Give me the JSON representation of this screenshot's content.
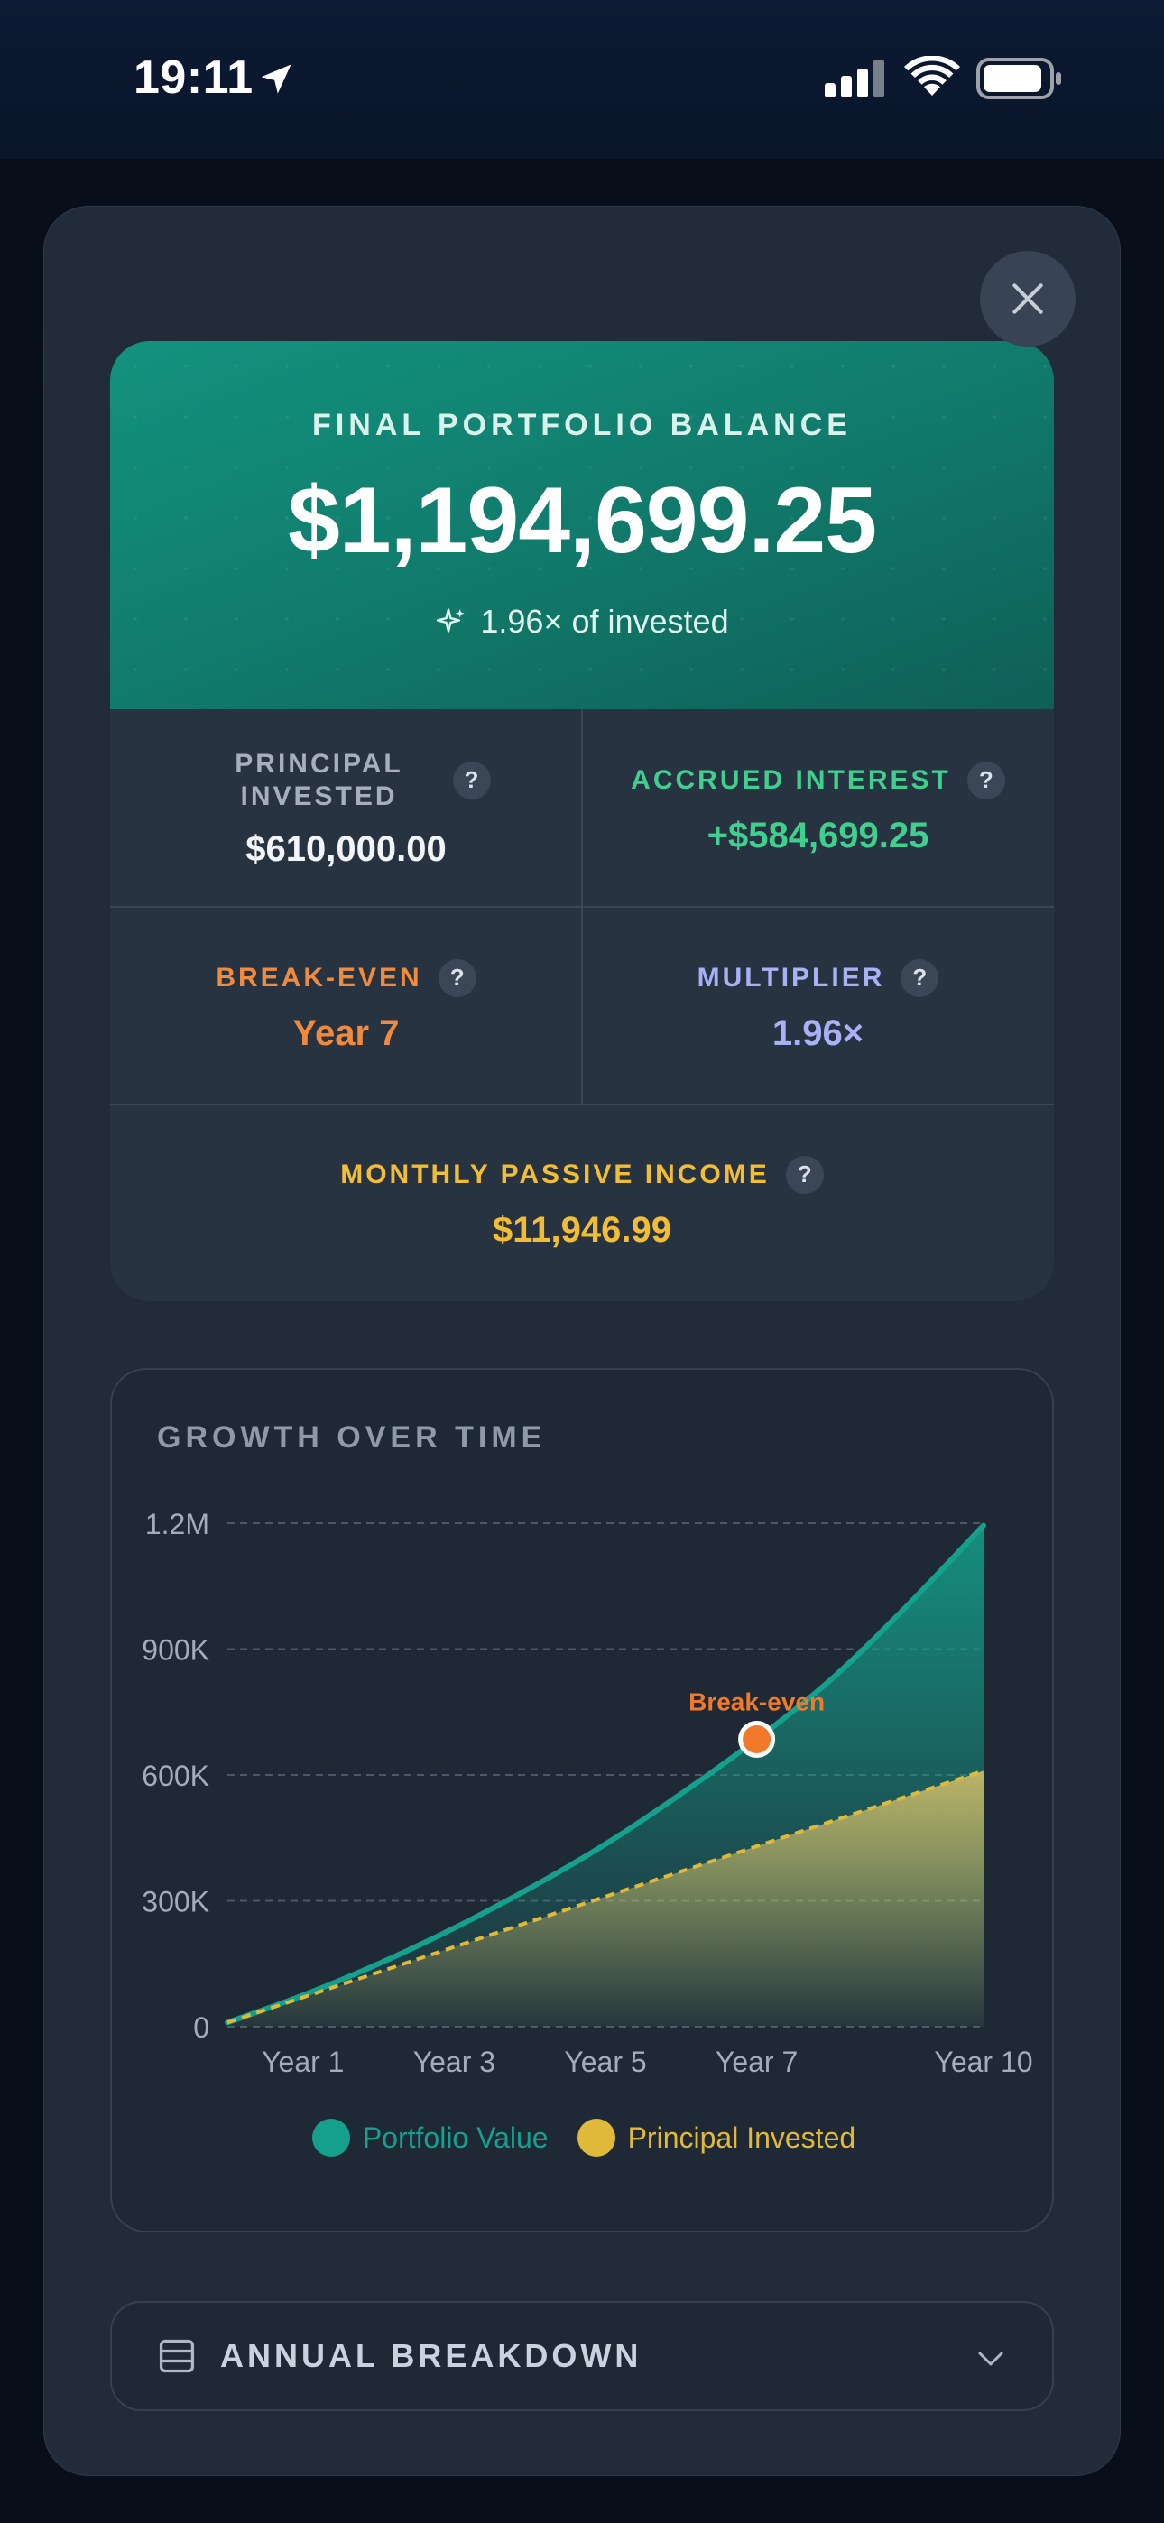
{
  "status_bar": {
    "time": "19:11"
  },
  "results": {
    "hero_title": "FINAL PORTFOLIO BALANCE",
    "hero_amount": "$1,194,699.25",
    "hero_sub": "1.96× of invested",
    "principal_label": "PRINCIPAL INVESTED",
    "principal_value": "$610,000.00",
    "interest_label": "ACCRUED INTEREST",
    "interest_value": "+$584,699.25",
    "breakeven_label": "BREAK-EVEN",
    "breakeven_value": "Year 7",
    "multiplier_label": "MULTIPLIER",
    "multiplier_value": "1.96×",
    "passive_label": "MONTHLY PASSIVE INCOME",
    "passive_value": "$11,946.99",
    "help_glyph": "?"
  },
  "colors": {
    "accent_teal": "#14a08c",
    "principal_gold": "#e0b93b",
    "breakeven_orange": "#f08a3e",
    "interest_green": "#3fcf8e",
    "multiplier_purple": "#a9b0f5",
    "passive_gold": "#f2bd36"
  },
  "chart": {
    "title": "GROWTH OVER TIME"
  },
  "chart_data": {
    "type": "area",
    "title": "GROWTH OVER TIME",
    "xlabel": "",
    "ylabel": "",
    "x": [
      0,
      1,
      2,
      3,
      4,
      5,
      6,
      7,
      8,
      9,
      10
    ],
    "x_tick_labels": [
      {
        "x": 1,
        "label": "Year 1"
      },
      {
        "x": 3,
        "label": "Year 3"
      },
      {
        "x": 5,
        "label": "Year 5"
      },
      {
        "x": 7,
        "label": "Year 7"
      },
      {
        "x": 10,
        "label": "Year 10"
      }
    ],
    "y_ticks": [
      0,
      300000,
      600000,
      900000,
      1200000
    ],
    "y_tick_labels": [
      "0",
      "300K",
      "600K",
      "900K",
      "1.2M"
    ],
    "ylim": [
      0,
      1200000
    ],
    "xlim": [
      0,
      10
    ],
    "grid": true,
    "legend_position": "bottom",
    "series": [
      {
        "name": "Portfolio Value",
        "color": "#14a08c",
        "style": "solid",
        "values": [
          10000,
          75000,
          150000,
          235000,
          330000,
          435000,
          555000,
          685000,
          830000,
          1005000,
          1194699.25
        ]
      },
      {
        "name": "Principal Invested",
        "color": "#e0b93b",
        "style": "dashed",
        "values": [
          10000,
          70000,
          130000,
          190000,
          250000,
          310000,
          370000,
          430000,
          490000,
          550000,
          610000
        ]
      }
    ],
    "annotations": [
      {
        "label": "Break-even",
        "x": 7,
        "y": 685000
      }
    ]
  },
  "breakdown": {
    "label": "ANNUAL BREAKDOWN"
  }
}
